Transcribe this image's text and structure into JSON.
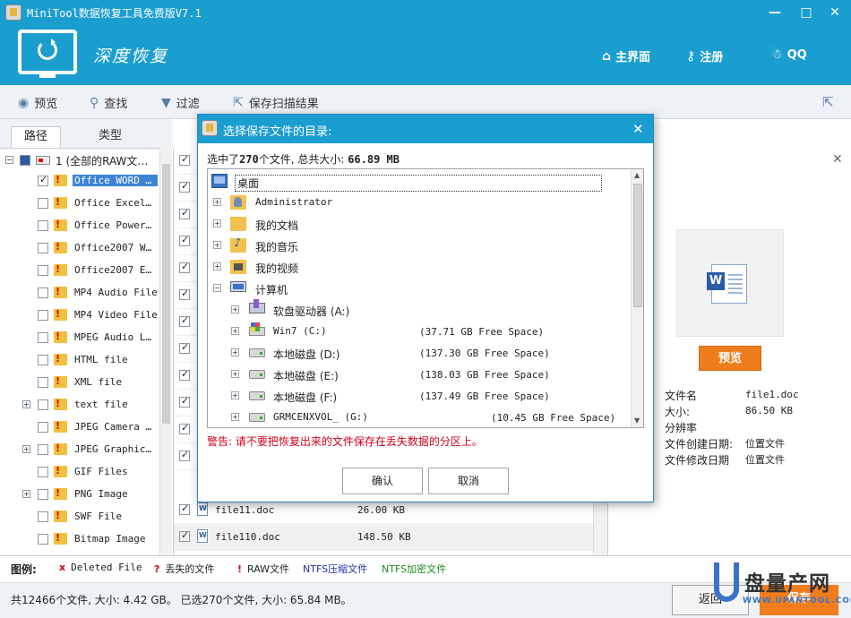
{
  "app": {
    "title": "MiniTool数据恢复工具免费版V7.1",
    "mode_title": "深度恢复",
    "window_controls": [
      "—",
      "□",
      "✕"
    ],
    "nav": [
      {
        "icon": "home-icon",
        "label": "主界面"
      },
      {
        "icon": "key-icon",
        "label": "注册"
      },
      {
        "icon": "qq-icon",
        "label": "QQ"
      }
    ]
  },
  "toolbar": {
    "preview": "预览",
    "find": "查找",
    "filter": "过滤",
    "save_scan": "保存扫描结果"
  },
  "left_panel": {
    "tabs": [
      "路径",
      "类型"
    ],
    "root_label": "1  (全部的RAW文…",
    "items": [
      {
        "label": "Office WORD …",
        "checked": true,
        "selected": true
      },
      {
        "label": "Office Excel…",
        "checked": false
      },
      {
        "label": "Office Power…",
        "checked": false
      },
      {
        "label": "Office2007 W…",
        "checked": false
      },
      {
        "label": "Office2007 E…",
        "checked": false
      },
      {
        "label": "MP4 Audio File",
        "checked": false
      },
      {
        "label": "MP4 Video File",
        "checked": false
      },
      {
        "label": "MPEG Audio L…",
        "checked": false
      },
      {
        "label": "HTML file",
        "checked": false
      },
      {
        "label": "XML file",
        "checked": false
      },
      {
        "label": "text file",
        "checked": false,
        "expandable": true
      },
      {
        "label": "JPEG Camera …",
        "checked": false
      },
      {
        "label": "JPEG Graphic…",
        "checked": false,
        "expandable": true
      },
      {
        "label": "GIF Files",
        "checked": false
      },
      {
        "label": "PNG Image",
        "checked": false,
        "expandable": true
      },
      {
        "label": "SWF File",
        "checked": false
      },
      {
        "label": "Bitmap Image",
        "checked": false
      }
    ]
  },
  "file_list": {
    "visible_rows": [
      {
        "name": "file11.doc",
        "size": "26.00 KB"
      },
      {
        "name": "file110.doc",
        "size": "148.50 KB"
      }
    ]
  },
  "preview_panel": {
    "button": "预览",
    "info": [
      {
        "label": "文件名",
        "value": "file1.doc"
      },
      {
        "label": "大小:",
        "value": "86.50 KB"
      },
      {
        "label": "分辨率",
        "value": ""
      },
      {
        "label": "文件创建日期:",
        "value": "位置文件"
      },
      {
        "label": "文件修改日期",
        "value": "位置文件"
      }
    ]
  },
  "legend": {
    "title": "图例:",
    "entries": [
      {
        "mark": "x",
        "label": "Deleted File",
        "color": "#d0021b"
      },
      {
        "mark": "?",
        "label": "丢失的文件",
        "color": "#d0021b"
      },
      {
        "mark": "!",
        "label": "RAW文件",
        "color": "#d0021b"
      },
      {
        "mark": "",
        "label": "NTFS压缩文件",
        "color": "#1f2fa8"
      },
      {
        "mark": "",
        "label": "NTFS加密文件",
        "color": "#1e8a1e"
      }
    ]
  },
  "status": {
    "text": "共12466个文件, 大小: 4.42 GB。 已选270个文件, 大小: 65.84 MB。",
    "back_button": "返回",
    "save_button": "保存"
  },
  "watermark": {
    "text": "盘量产网",
    "url": "WWW.UPANTOOL.COM"
  },
  "dialog": {
    "title": "选择保存文件的目录:",
    "summary_prefix": "选中了",
    "summary_count": "270",
    "summary_mid": "个文件, 总共大小: ",
    "summary_size": "66.89 MB",
    "tree": {
      "desktop": "桌面",
      "items": [
        {
          "label": "Administrator",
          "icon": "user-folder-icon"
        },
        {
          "label": "我的文档",
          "icon": "documents-folder-icon"
        },
        {
          "label": "我的音乐",
          "icon": "music-folder-icon"
        },
        {
          "label": "我的视频",
          "icon": "video-folder-icon"
        },
        {
          "label": "计算机",
          "icon": "computer-icon"
        }
      ],
      "drives": [
        {
          "label": "软盘驱动器 (A:)",
          "free": "",
          "icon": "floppy-drive-icon"
        },
        {
          "label": "Win7 (C:)",
          "free": "(37.71 GB Free Space)",
          "icon": "windows-drive-icon"
        },
        {
          "label": "本地磁盘 (D:)",
          "free": "(137.30 GB Free Space)",
          "icon": "hard-drive-icon"
        },
        {
          "label": "本地磁盘 (E:)",
          "free": "(138.03 GB Free Space)",
          "icon": "hard-drive-icon"
        },
        {
          "label": "本地磁盘 (F:)",
          "free": "(137.49 GB Free Space)",
          "icon": "hard-drive-icon"
        },
        {
          "label": "GRMCENXVOL_ (G:)",
          "free": "(10.45 GB Free Space)",
          "icon": "usb-drive-icon"
        }
      ]
    },
    "warning": "警告: 请不要把恢复出来的文件保存在丢失数据的分区上。",
    "confirm": "确认",
    "cancel": "取消"
  },
  "colors": {
    "header_blue": "#1a9ed0",
    "accent_orange": "#f07d1b",
    "warning_red": "#d0021b"
  }
}
